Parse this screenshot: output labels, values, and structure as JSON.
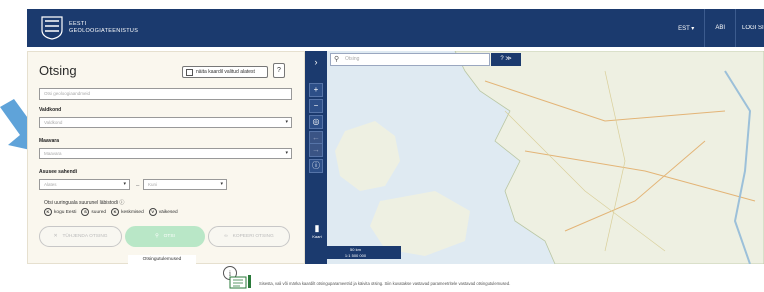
{
  "header": {
    "brand_line1": "EESTI",
    "brand_line2": "GEOLOOGIATEENISTUS",
    "lang": "EST ▾",
    "help": "ABI",
    "login": "LOGI SISSE"
  },
  "search_panel": {
    "title": "Otsing",
    "show_on_map_label": "näita kaardil valitud alatest",
    "help_button": "?",
    "main_input_placeholder": "Otsi geoloogiaandmeid",
    "field_label": "Valdkond",
    "field_placeholder": "Valdkond",
    "county_label": "Maavara",
    "county_placeholder": "Maavara",
    "depth_label": "Asusee sahendi",
    "depth_from_placeholder": "Alates",
    "depth_to_placeholder": "Kuni",
    "radio_group_label": "Otsi uuringuala suurunel läbistodi",
    "radios": [
      {
        "key": "K",
        "label": "kogu Eesti"
      },
      {
        "key": "S",
        "label": "suured"
      },
      {
        "key": "K",
        "label": "keskmised"
      },
      {
        "key": "V",
        "label": "väikesed"
      }
    ],
    "reset_label": "TÜHJENDA OTSING",
    "search_label": "OTSI",
    "copy_label": "KOPEERI OTSING",
    "results_tab": "Otsingutulemused"
  },
  "map": {
    "search_placeholder": "Otsing",
    "tools_label": "? ≫",
    "layers_label": "Kaart",
    "scale_label": "50 km",
    "scale_ratio": "1:1 500 000"
  },
  "footer": {
    "hint": "Sisesta, vali või märka kaardilt otsinguparameetrid ja käivita otsing. Siin kuvatakse vastavad parameetritele vastavad otsingutulemused."
  },
  "colors": {
    "header_bg": "#1b3a6e",
    "panel_bg": "#faf7ee",
    "search_button": "#b9e7c7",
    "arrow": "#5fa3d9"
  }
}
